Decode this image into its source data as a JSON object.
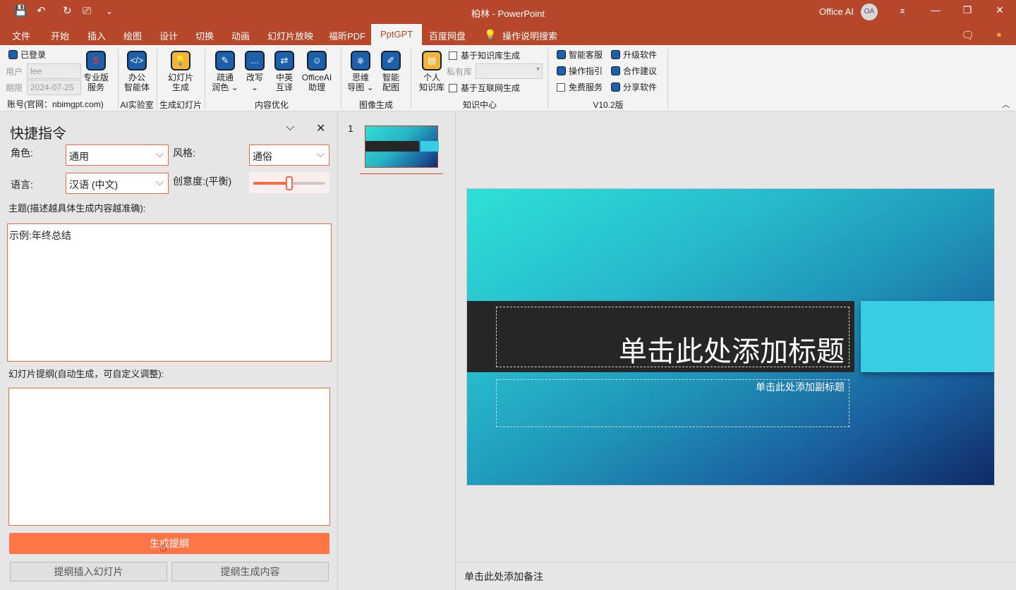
{
  "window": {
    "title": "柏林  -  PowerPoint",
    "office_ai": "Office AI",
    "avatar": "OA"
  },
  "quick_access": {
    "save": "💾",
    "undo": "↶",
    "redo": "↻",
    "slideshow": "⎚",
    "customize": "⌄"
  },
  "window_controls": {
    "ribbon_display": "⌅",
    "minimize": "—",
    "restore": "❐",
    "close": "✕"
  },
  "tabs": [
    "文件",
    "开始",
    "插入",
    "绘图",
    "设计",
    "切换",
    "动画",
    "幻灯片放映",
    "福昕PDF",
    "PptGPT",
    "百度网盘",
    "操作说明搜索"
  ],
  "active_tab": "PptGPT",
  "ribbon": {
    "logged_in": "已登录",
    "user_label": "用户",
    "user_value": "lee",
    "expiry_label": "期限",
    "expiry_value": "2024-07-25",
    "account": "账号(官网：nbimgpt.com)",
    "pro_service": [
      "专业版",
      "服务"
    ],
    "office_agent": [
      "办公",
      "智能体"
    ],
    "ai_lab": "AI实验室",
    "slide_gen": [
      "幻灯片",
      "生成"
    ],
    "slide_gen_group": "生成幻灯片",
    "polish": [
      "疏通",
      "润色 ⌄"
    ],
    "rewrite": [
      "改写",
      "⌄"
    ],
    "translate": [
      "中英",
      "互译"
    ],
    "assistant": [
      "OfficeAI",
      "助理"
    ],
    "content_group": "内容优化",
    "mindmap": [
      "思维",
      "导图 ⌄"
    ],
    "smart_image": [
      "智能",
      "配图"
    ],
    "image_group": "图像生成",
    "personal_kb": [
      "个人",
      "知识库"
    ],
    "kb_gen": "基于知识库生成",
    "private_lib": "私有库",
    "web_gen": "基于互联网生成",
    "knowledge_group": "知识中心",
    "support": "智能客服",
    "guide": "操作指引",
    "free": "免费服务",
    "upgrade": "升级软件",
    "suggest": "合作建议",
    "share": "分享软件",
    "version_group": "V10.2版"
  },
  "panel": {
    "title": "快捷指令",
    "role_label": "角色:",
    "role_value": "通用",
    "style_label": "风格:",
    "style_value": "通俗",
    "lang_label": "语言:",
    "lang_value": "汉语 (中文)",
    "creativity_label": "创意度:(平衡)",
    "creativity_level": 0.5,
    "topic_label": "主题(描述越具体生成内容越准确):",
    "topic_value": "示例:年终总结",
    "outline_label": "幻灯片提纲(自动生成，可自定义调整):",
    "outline_value": "",
    "gen_outline": "生成提纲",
    "insert_outline": "提纲插入幻灯片",
    "gen_content": "提纲生成内容"
  },
  "thumbnails": {
    "number": "1"
  },
  "slide": {
    "title_placeholder": "单击此处添加标题",
    "subtitle_placeholder": "单击此处添加副标题"
  },
  "notes": {
    "placeholder": "单击此处添加备注"
  },
  "colors": {
    "brand": "#b7472a",
    "accent": "#f26b43",
    "button": "#ff7548"
  }
}
